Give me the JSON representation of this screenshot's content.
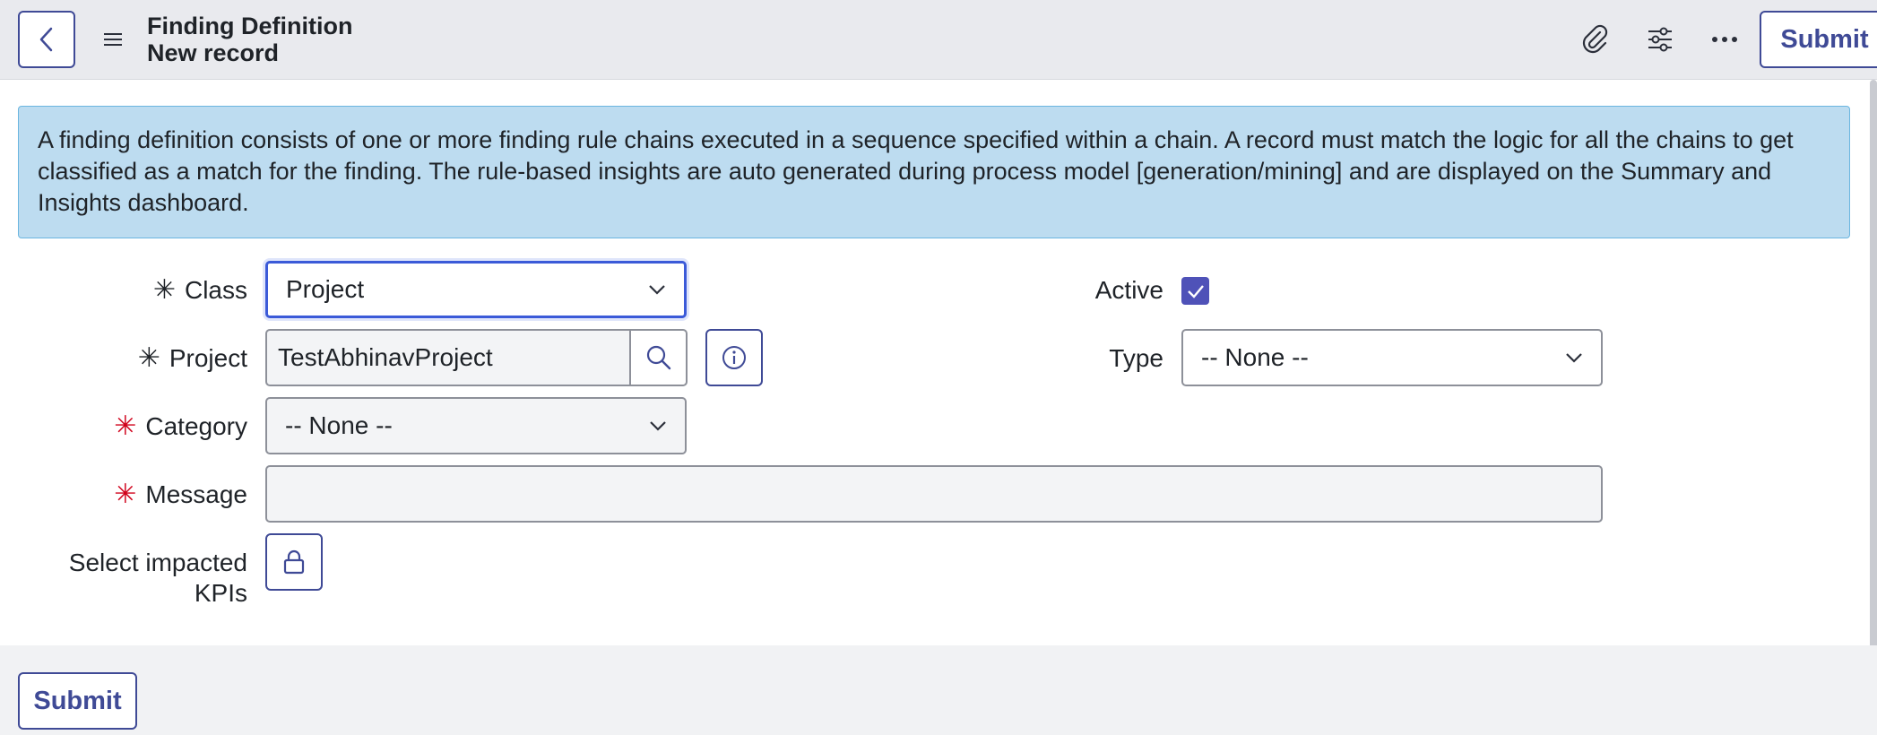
{
  "header": {
    "title": "Finding Definition",
    "subtitle": "New record",
    "submit_label": "Submit",
    "icons": [
      "chevron-left-icon",
      "hamburger-menu-icon",
      "paperclip-icon",
      "sliders-icon",
      "ellipsis-icon"
    ]
  },
  "info_banner": {
    "text": "A finding definition consists of one or more finding rule chains executed in a sequence specified within a chain. A record must match the logic for all the chains to get classified as a match for the finding. The rule-based insights are auto generated during process model [generation/mining] and are displayed on the Summary and Insights dashboard."
  },
  "form": {
    "class": {
      "label": "Class",
      "value": "Project",
      "required_mark": "✳"
    },
    "project": {
      "label": "Project",
      "value": "TestAbhinavProject",
      "required_mark": "✳"
    },
    "category": {
      "label": "Category",
      "value": "-- None --",
      "required_mark": "✳"
    },
    "message": {
      "label": "Message",
      "value": "",
      "required_mark": "✳"
    },
    "impacted_kpis": {
      "label_line1": "Select impacted",
      "label_line2": "KPIs"
    },
    "active": {
      "label": "Active",
      "checked": true
    },
    "type": {
      "label": "Type",
      "value": "-- None --"
    }
  },
  "footer": {
    "submit_label": "Submit"
  },
  "colors": {
    "accent": "#3f4a96",
    "checkbox": "#4f52b8",
    "banner_bg": "#bddcf0",
    "required_red": "#d0021b",
    "focus_blue": "#3b5ad8"
  }
}
